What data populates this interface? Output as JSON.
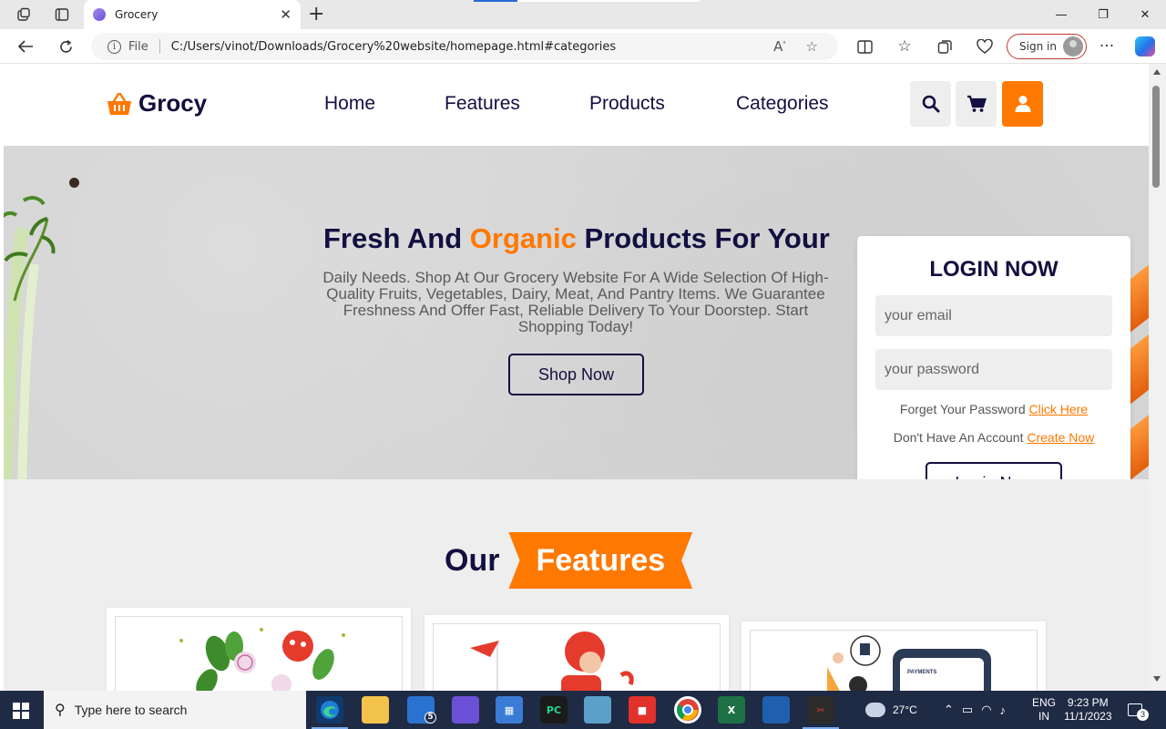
{
  "browser": {
    "tab_title": "Grocery",
    "address_label": "File",
    "url": "C:/Users/vinot/Downloads/Grocery%20website/homepage.html#categories",
    "sign_in": "Sign in"
  },
  "site": {
    "logo_text": "Grocy",
    "nav": [
      {
        "label": "Home"
      },
      {
        "label": "Features"
      },
      {
        "label": "Products"
      },
      {
        "label": "Categories"
      }
    ],
    "hero": {
      "title_start": "Fresh And",
      "title_highlight": "Organic",
      "title_end": "Products For Your",
      "description": "Daily Needs. Shop At Our Grocery Website For A Wide Selection Of High-Quality Fruits, Vegetables, Dairy, Meat, And Pantry Items. We Guarantee Freshness And Offer Fast, Reliable Delivery To Your Doorstep. Start Shopping Today!",
      "button": "Shop Now"
    },
    "login": {
      "title": "LOGIN NOW",
      "email_placeholder": "your email",
      "password_placeholder": "your password",
      "forgot_text": "Forget Your Password",
      "forgot_link": "Click Here",
      "account_text": "Don't Have An Account",
      "account_link": "Create Now",
      "button": "Login Now"
    },
    "features": {
      "title_plain": "Our",
      "title_ribbon": "Features"
    }
  },
  "taskbar": {
    "search_placeholder": "Type here to search",
    "mail_badge": "5",
    "temperature": "27°C",
    "language": "ENG",
    "region": "IN",
    "time": "9:23 PM",
    "date": "11/1/2023",
    "notifications": "3"
  },
  "colors": {
    "brand_dark": "#130f40",
    "accent": "#ff7800",
    "taskbar": "#1f2a44"
  }
}
